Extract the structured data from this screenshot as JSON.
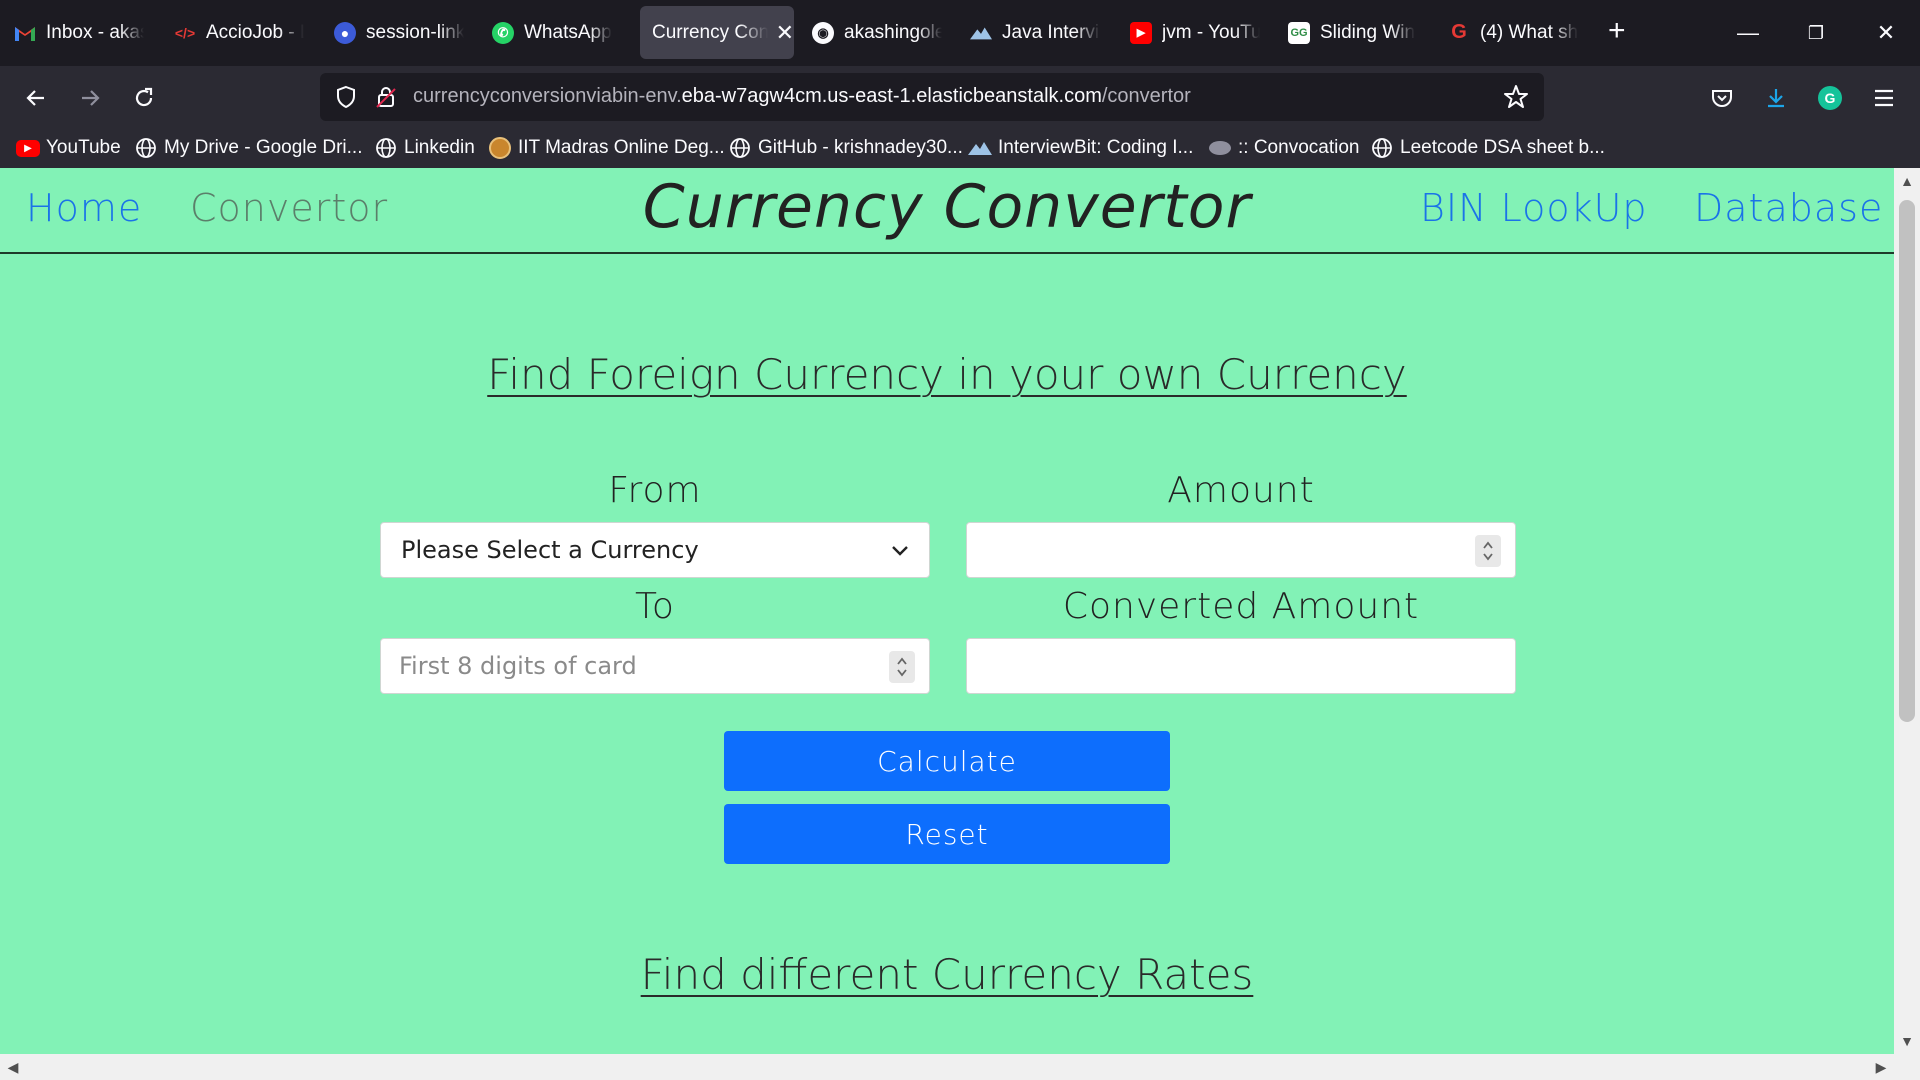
{
  "browser": {
    "tabs": [
      {
        "label": "Inbox - akas",
        "icon": "gmail-icon",
        "active": false
      },
      {
        "label": "AccioJob - L",
        "icon": "acciojob-icon",
        "active": false
      },
      {
        "label": "session-link",
        "icon": "meet-icon",
        "active": false
      },
      {
        "label": "WhatsApp",
        "icon": "whatsapp-icon",
        "active": false
      },
      {
        "label": "Currency Con",
        "icon": "",
        "active": true
      },
      {
        "label": "akashingole",
        "icon": "github-icon",
        "active": false
      },
      {
        "label": "Java Intervie",
        "icon": "interviewbit-icon",
        "active": false
      },
      {
        "label": "jvm - YouTu",
        "icon": "youtube-icon",
        "active": false
      },
      {
        "label": "Sliding Win",
        "icon": "gfg-icon",
        "active": false
      },
      {
        "label": "(4) What sh",
        "icon": "quora-icon",
        "active": false
      }
    ],
    "url": {
      "prefix": "currencyconversionviabin-env.",
      "domain": "eba-w7agw4cm.us-east-1.elasticbeanstalk.com",
      "path": "/convertor"
    },
    "bookmarks": [
      {
        "label": "YouTube",
        "icon": "youtube-icon"
      },
      {
        "label": "My Drive - Google Dri...",
        "icon": "globe-icon"
      },
      {
        "label": "Linkedin",
        "icon": "globe-icon"
      },
      {
        "label": "IIT Madras Online Deg...",
        "icon": "iitm-icon"
      },
      {
        "label": "GitHub - krishnadey30...",
        "icon": "globe-icon"
      },
      {
        "label": "InterviewBit: Coding I...",
        "icon": "interviewbit-icon"
      },
      {
        "label": ":: Convocation",
        "icon": "convocation-icon"
      },
      {
        "label": "Leetcode DSA sheet b...",
        "icon": "globe-icon"
      }
    ]
  },
  "page": {
    "nav": {
      "home": "Home",
      "convertor": "Convertor",
      "title": "Currency Convertor",
      "bin_lookup": "BIN LookUp",
      "database": "Database"
    },
    "section1_title": "Find Foreign Currency in your own Currency",
    "form": {
      "from_label": "From",
      "from_value": "Please Select a Currency",
      "amount_label": "Amount",
      "amount_value": "",
      "to_label": "To",
      "to_placeholder": "First 8 digits of card",
      "converted_label": "Converted Amount",
      "converted_value": ""
    },
    "buttons": {
      "calculate": "Calculate",
      "reset": "Reset"
    },
    "section2_title": "Find different Currency Rates"
  },
  "colors": {
    "page_bg": "#82f2b6",
    "link": "#1a73e8",
    "button": "#0d6efd"
  }
}
